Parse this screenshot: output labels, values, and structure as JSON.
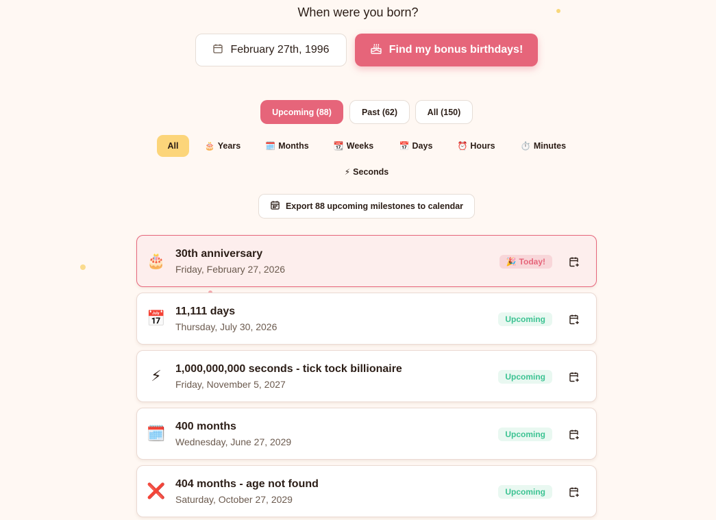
{
  "header": {
    "question": "When were you born?",
    "birth_date": "February 27th, 1996",
    "find_button": "Find my bonus birthdays!"
  },
  "tabs": [
    {
      "label": "Upcoming (88)",
      "active": true
    },
    {
      "label": "Past (62)",
      "active": false
    },
    {
      "label": "All (150)",
      "active": false
    }
  ],
  "filters": [
    {
      "label": "All",
      "emoji": ""
    },
    {
      "label": "Years",
      "emoji": "🎂"
    },
    {
      "label": "Months",
      "emoji": "🗓️"
    },
    {
      "label": "Weeks",
      "emoji": "📆"
    },
    {
      "label": "Days",
      "emoji": "📅"
    },
    {
      "label": "Hours",
      "emoji": "⏰"
    },
    {
      "label": "Minutes",
      "emoji": "⏱️"
    },
    {
      "label": "Seconds",
      "emoji": "⚡"
    }
  ],
  "export_label": "Export 88 upcoming milestones to calendar",
  "milestones": [
    {
      "emoji": "🎂",
      "title": "30th anniversary",
      "date": "Friday, February 27, 2026",
      "status": "Today!",
      "status_emoji": "🎉"
    },
    {
      "emoji": "📅",
      "title": "11,111 days",
      "date": "Thursday, July 30, 2026",
      "status": "Upcoming"
    },
    {
      "emoji": "⚡",
      "title": "1,000,000,000 seconds - tick tock billionaire",
      "date": "Friday, November 5, 2027",
      "status": "Upcoming"
    },
    {
      "emoji": "🗓️",
      "title": "400 months",
      "date": "Wednesday, June 27, 2029",
      "status": "Upcoming"
    },
    {
      "emoji": "❌",
      "title": "404 months - age not found",
      "date": "Saturday, October 27, 2029",
      "status": "Upcoming"
    }
  ],
  "colors": {
    "accent": "#e6657a",
    "filter_active": "#fcd57a",
    "upcoming_text": "#3dc393",
    "background": "#fff8f3"
  }
}
